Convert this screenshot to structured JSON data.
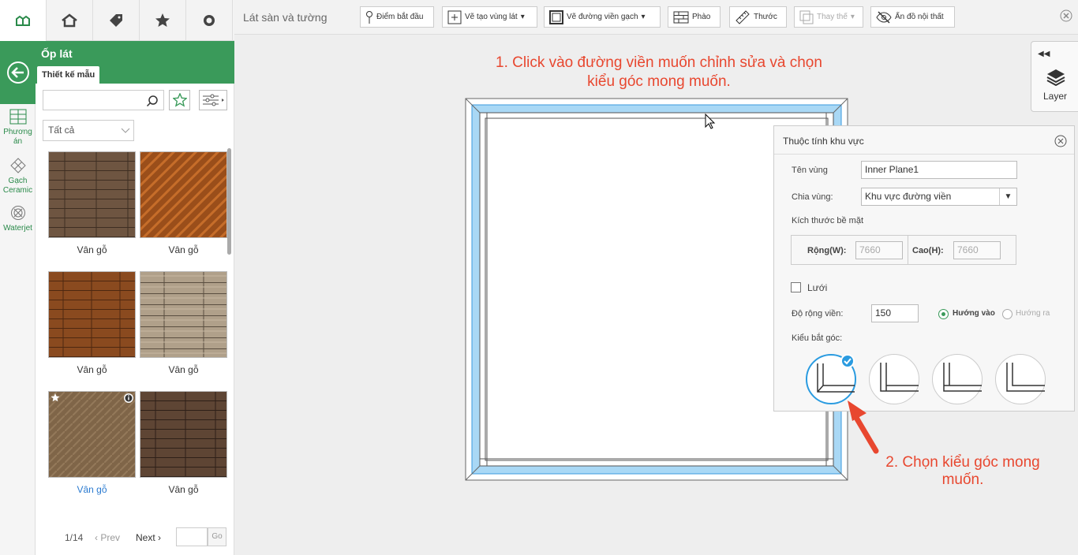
{
  "toptabs": [
    "home-tile-icon",
    "house-tiles-icon",
    "tag-icon",
    "star-icon",
    "search-icon"
  ],
  "sidebar": {
    "title": "Ốp lát",
    "tab": "Thiết kế mẫu",
    "rail": [
      {
        "label1": "Phương",
        "label2": "án"
      },
      {
        "label1": "Gạch",
        "label2": "Ceramic"
      },
      {
        "label1": "Waterjet",
        "label2": ""
      }
    ],
    "category": "Tất cả",
    "items": [
      {
        "label": "Vân gỗ"
      },
      {
        "label": "Vân gỗ"
      },
      {
        "label": "Vân gỗ"
      },
      {
        "label": "Vân gỗ"
      },
      {
        "label": "Vân gỗ"
      },
      {
        "label": "Vân gỗ"
      }
    ],
    "pager": {
      "page": "1/14",
      "prev": "Prev",
      "next": "Next",
      "go": "Go"
    }
  },
  "toolbar": {
    "title": "Lát sàn và tường",
    "start_point": "Điểm bắt đầu",
    "draw_area": "Vẽ tạo vùng lát",
    "draw_border": "Vẽ đường viền gạch",
    "moulding": "Phào",
    "ruler": "Thước",
    "replace": "Thay thế",
    "hide_furniture": "Ẩn đồ nội thất"
  },
  "annotations": {
    "step1_line1": "1. Click vào đường viền muốn chỉnh sửa và chọn",
    "step1_line2": "kiểu góc mong muốn.",
    "step2_line1": "2. Chọn kiểu góc mong",
    "step2_line2": "muốn."
  },
  "layer": {
    "label": "Layer"
  },
  "panel": {
    "title": "Thuộc tính khu vực",
    "name_label": "Tên vùng",
    "name_value": "Inner Plane1",
    "split_label": "Chia vùng:",
    "split_value": "Khu vực đường viền",
    "size_label": "Kích thước bề mặt",
    "width_label": "Rộng(W):",
    "width_value": "7660",
    "height_label": "Cao(H):",
    "height_value": "7660",
    "grid_label": "Lưới",
    "border_width_label": "Độ rộng viền:",
    "border_width_value": "150",
    "dir_in": "Hướng vào",
    "dir_out": "Hướng ra",
    "corner_label": "Kiểu bắt góc:"
  },
  "colors": {
    "brand": "#3a9a5a",
    "annotation": "#e8472f",
    "selected": "#2a9be0",
    "border_fill": "#a9d8f5"
  }
}
